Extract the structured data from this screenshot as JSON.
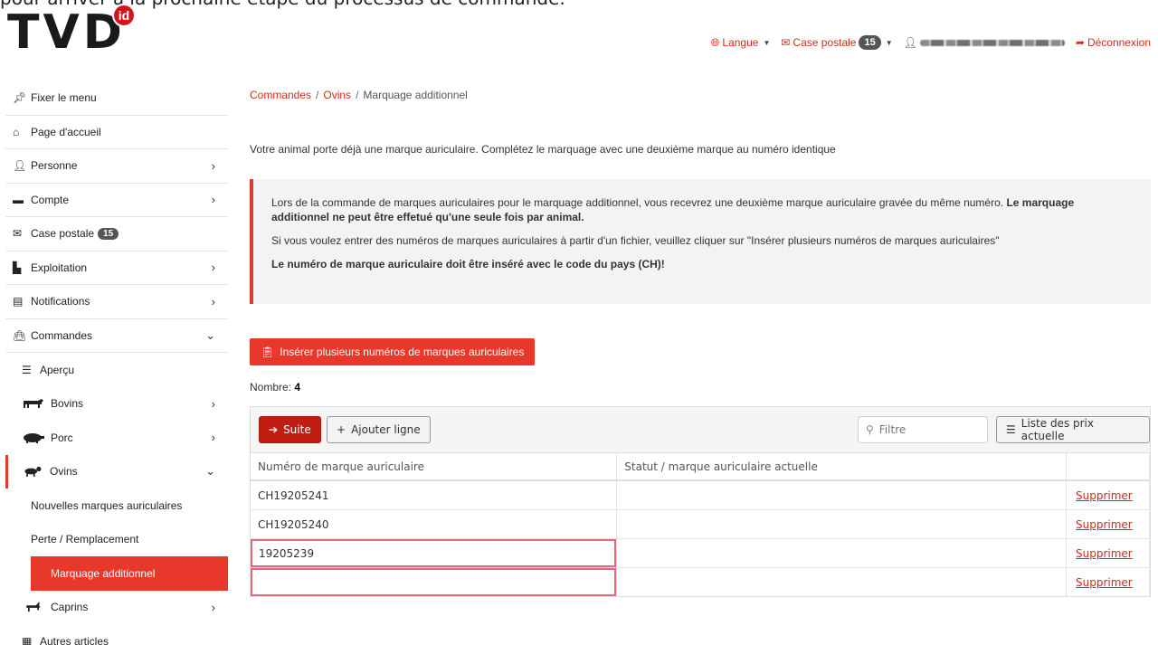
{
  "cutline_text": "pour arriver à la prochaine étape du processus de commande.",
  "logo": {
    "text": "TVD",
    "badge": "id"
  },
  "topnav": {
    "language": "Langue",
    "mailbox": "Case postale",
    "mailbox_count": "15",
    "logout": "Déconnexion"
  },
  "sidebar": {
    "pin": "Fixer le menu",
    "home": "Page d'accueil",
    "person": "Personne",
    "account": "Compte",
    "mailbox": "Case postale",
    "mailbox_count": "15",
    "exploitation": "Exploitation",
    "notifications": "Notifications",
    "orders": "Commandes",
    "overview": "Aperçu",
    "cattle": "Bovins",
    "pig": "Porc",
    "sheep": "Ovins",
    "new_tags": "Nouvelles marques auriculaires",
    "loss": "Perte / Remplacement",
    "additional": "Marquage additionnel",
    "goats": "Caprins",
    "other": "Autres articles"
  },
  "breadcrumb": {
    "orders": "Commandes",
    "sheep": "Ovins",
    "current": "Marquage additionnel",
    "sep": "/"
  },
  "intro": "Votre animal porte déjà une marque auriculaire. Complétez le marquage avec une deuxième marque au numéro identique",
  "alert": {
    "p1_normal": "Lors de la commande de marques auriculaires pour le marquage additionnel, vous recevrez une deuxième marque auriculaire gravée du même numéro.",
    "p1_bold": "Le marquage additionnel ne peut être effetué qu'une seule fois par animal.",
    "p2": "Si vous voulez entrer des numéros de marques auriculaires à partir d'un fichier, veuillez cliquer sur \"Insérer plusieurs numéros de marques auriculaires\"",
    "p3": "Le numéro de marque auriculaire doit être inséré avec le code du pays (CH)!"
  },
  "insert_button": "Insérer plusieurs numéros de marques auriculaires",
  "count": {
    "label": "Nombre:",
    "value": "4"
  },
  "toolbar": {
    "suite": "Suite",
    "add_line": "Ajouter ligne",
    "filter_placeholder": "Filtre",
    "prices": "Liste des prix actuelle"
  },
  "table": {
    "headers": [
      "Numéro de marque auriculaire",
      "Statut / marque auriculaire actuelle",
      ""
    ],
    "rows": [
      {
        "number": "CH19205241",
        "status": "",
        "action": "Supprimer"
      },
      {
        "number": "CH19205240",
        "status": "",
        "action": "Supprimer"
      },
      {
        "number": "19205239",
        "status": "",
        "action": "Supprimer"
      },
      {
        "number": "",
        "status": "",
        "action": "Supprimer"
      }
    ]
  },
  "colors": {
    "accent": "#e8382b",
    "suite": "#c01d13",
    "error_border": "#e06a7a",
    "badge": "#555555"
  }
}
